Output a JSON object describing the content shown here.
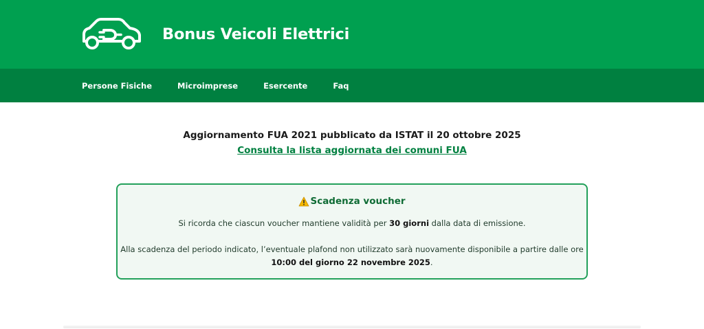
{
  "header": {
    "title": "Bonus Veicoli Elettrici",
    "logo_icon": "electric-car-plug-icon"
  },
  "nav": {
    "items": [
      {
        "label": "Persone Fisiche"
      },
      {
        "label": "Microimprese"
      },
      {
        "label": "Esercente"
      },
      {
        "label": "Faq"
      }
    ]
  },
  "announcement": {
    "title": "Aggiornamento FUA 2021 pubblicato da ISTAT il 20 ottobre 2025",
    "link": "Consulta la lista aggiornata dei comuni FUA"
  },
  "notice": {
    "icon": "warning-icon",
    "title": "Scadenza voucher",
    "p1_before": "Si ricorda che ciascun voucher mantiene validità per ",
    "p1_bold": "30 giorni",
    "p1_after": " dalla data di emissione.",
    "p2_text": "Alla scadenza del periodo indicato, l’eventuale plafond non utilizzato sarà nuovamente disponibile a partire dalle ore",
    "p2_bold": "10:00 del giorno 22 novembre 2025",
    "p2_after": "."
  },
  "colors": {
    "header_bg": "#00a050",
    "nav_bg": "#008040",
    "accent": "#008040",
    "notice_border": "#22a05a",
    "notice_bg": "#f1f8f3"
  }
}
